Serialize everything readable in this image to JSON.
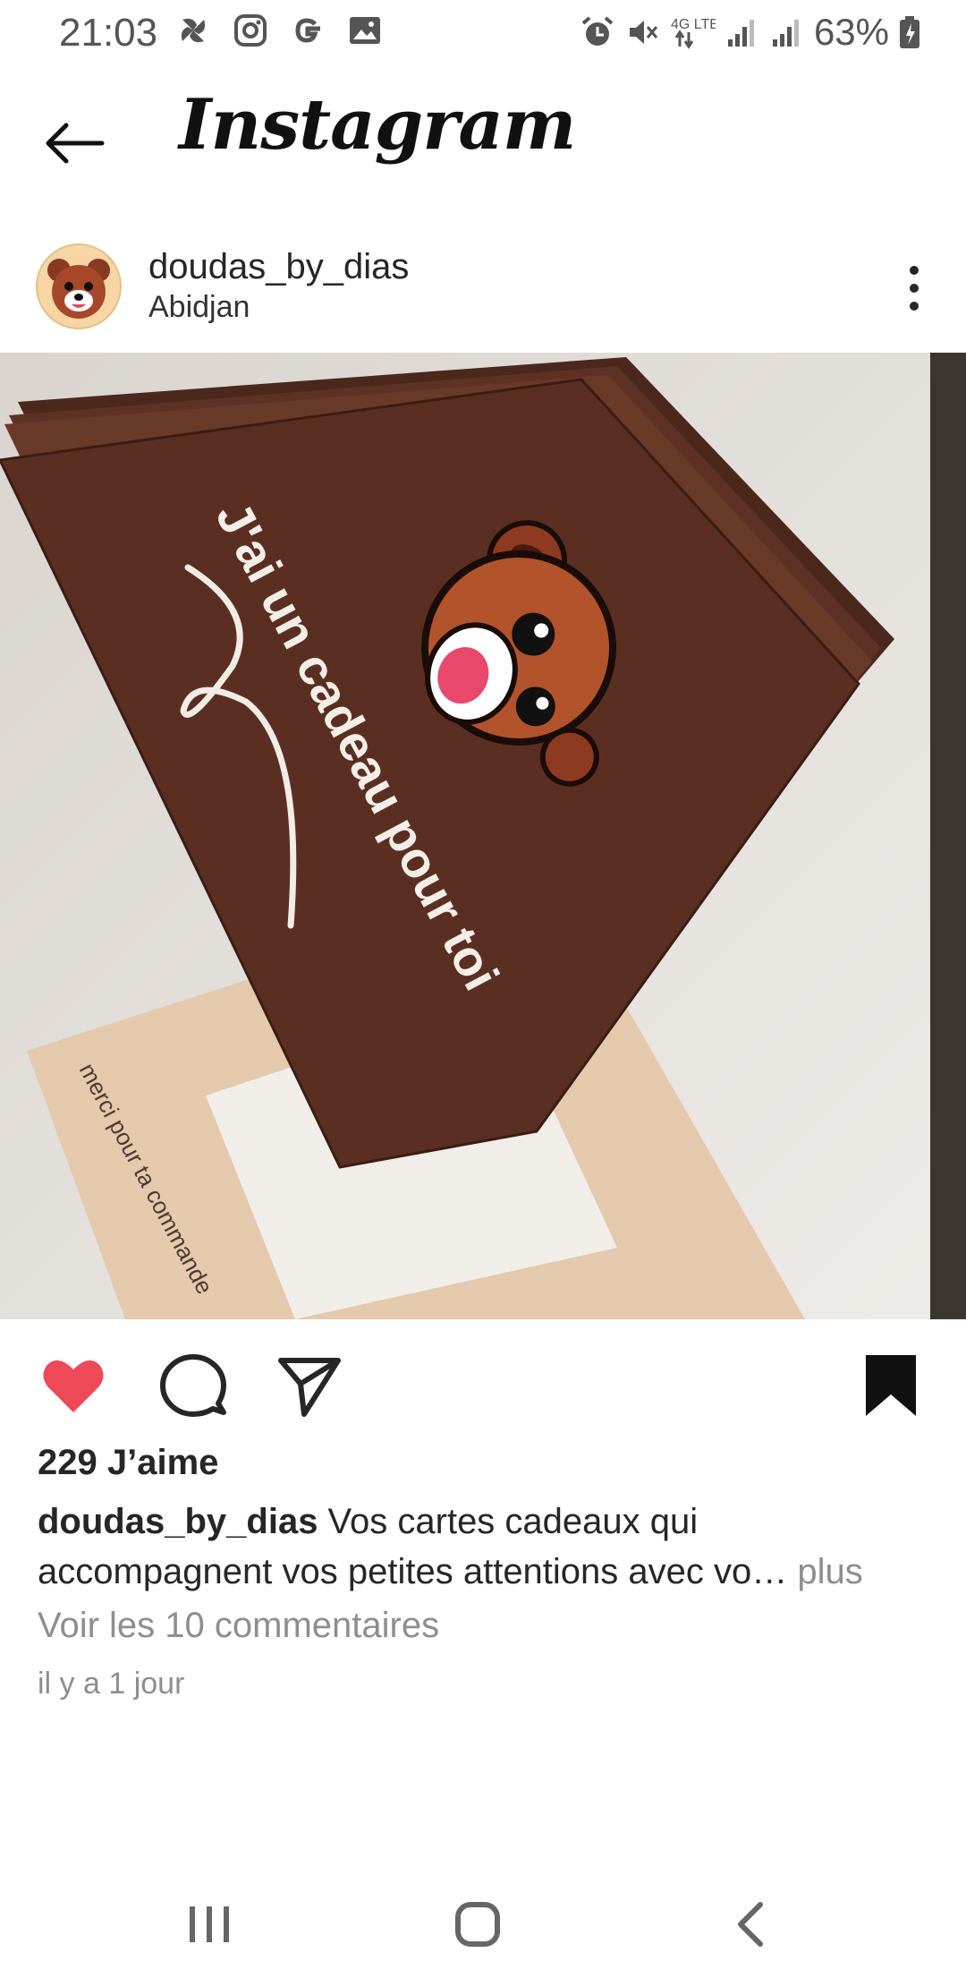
{
  "status": {
    "time": "21:03",
    "battery": "63%",
    "network": "4G LTE",
    "icons": [
      "pinwheel-icon",
      "instagram-icon",
      "google-icon",
      "image-icon",
      "alarm-icon",
      "mute-icon",
      "network-icon",
      "signal-icon",
      "signal-icon",
      "battery-icon"
    ]
  },
  "header": {
    "title": "Instagram",
    "back_icon": "back-arrow-icon"
  },
  "post": {
    "username": "doudas_by_dias",
    "location": "Abidjan",
    "image": {
      "card_text": "J'ai un cadeau pour toi",
      "envelope_text": "merci pour ta commande"
    },
    "actions": {
      "like": "heart-icon",
      "comment": "comment-icon",
      "share": "send-icon",
      "save": "bookmark-icon"
    },
    "likes": "229 J’aime",
    "caption_user": "doudas_by_dias",
    "caption_text": " Vos cartes cadeaux qui accompagnent vos petites attentions avec vo…",
    "caption_more": " plus",
    "comments_link": "Voir les 10 commentaires",
    "time": "il y a 1 jour"
  },
  "colors": {
    "like_red": "#ed4956",
    "card_brown": "#5a2f22"
  }
}
